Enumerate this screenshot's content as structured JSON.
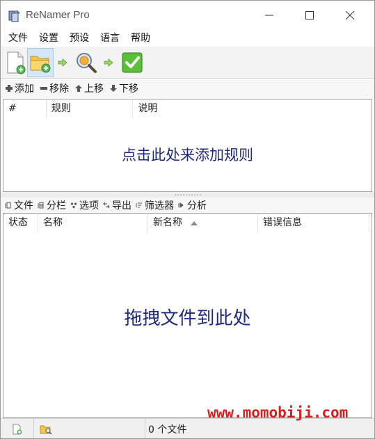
{
  "window": {
    "title": "ReNamer Pro"
  },
  "menu": [
    {
      "label": "文件"
    },
    {
      "label": "设置"
    },
    {
      "label": "预设"
    },
    {
      "label": "语言"
    },
    {
      "label": "帮助"
    }
  ],
  "toolbar": {
    "icons": [
      "add-files-icon",
      "add-folders-icon",
      "preview-icon",
      "rename-icon"
    ]
  },
  "rules_actions": [
    {
      "label": "添加",
      "icon": "plus-icon"
    },
    {
      "label": "移除",
      "icon": "minus-icon"
    },
    {
      "label": "上移",
      "icon": "arrow-up-icon"
    },
    {
      "label": "下移",
      "icon": "arrow-down-icon"
    }
  ],
  "rules_table": {
    "columns": [
      "#",
      "规则",
      "说明"
    ],
    "placeholder": "点击此处来添加规则"
  },
  "files_actions": [
    {
      "label": "文件",
      "icon": "files-icon"
    },
    {
      "label": "分栏",
      "icon": "columns-icon"
    },
    {
      "label": "选项",
      "icon": "options-icon"
    },
    {
      "label": "导出",
      "icon": "export-icon"
    },
    {
      "label": "筛选器",
      "icon": "filter-icon"
    },
    {
      "label": "分析",
      "icon": "analyze-icon"
    }
  ],
  "files_table": {
    "columns": [
      "状态",
      "名称",
      "新名称",
      "错误信息"
    ],
    "sorted_column": "新名称",
    "placeholder": "拖拽文件到此处"
  },
  "statusbar": {
    "file_count": "0 个文件"
  },
  "watermark": "www.momobiji.com",
  "colors": {
    "placeholder_text": "#1f2a7a",
    "watermark": "#d81e1e",
    "toolbar_hover": "#d5e6f7"
  }
}
